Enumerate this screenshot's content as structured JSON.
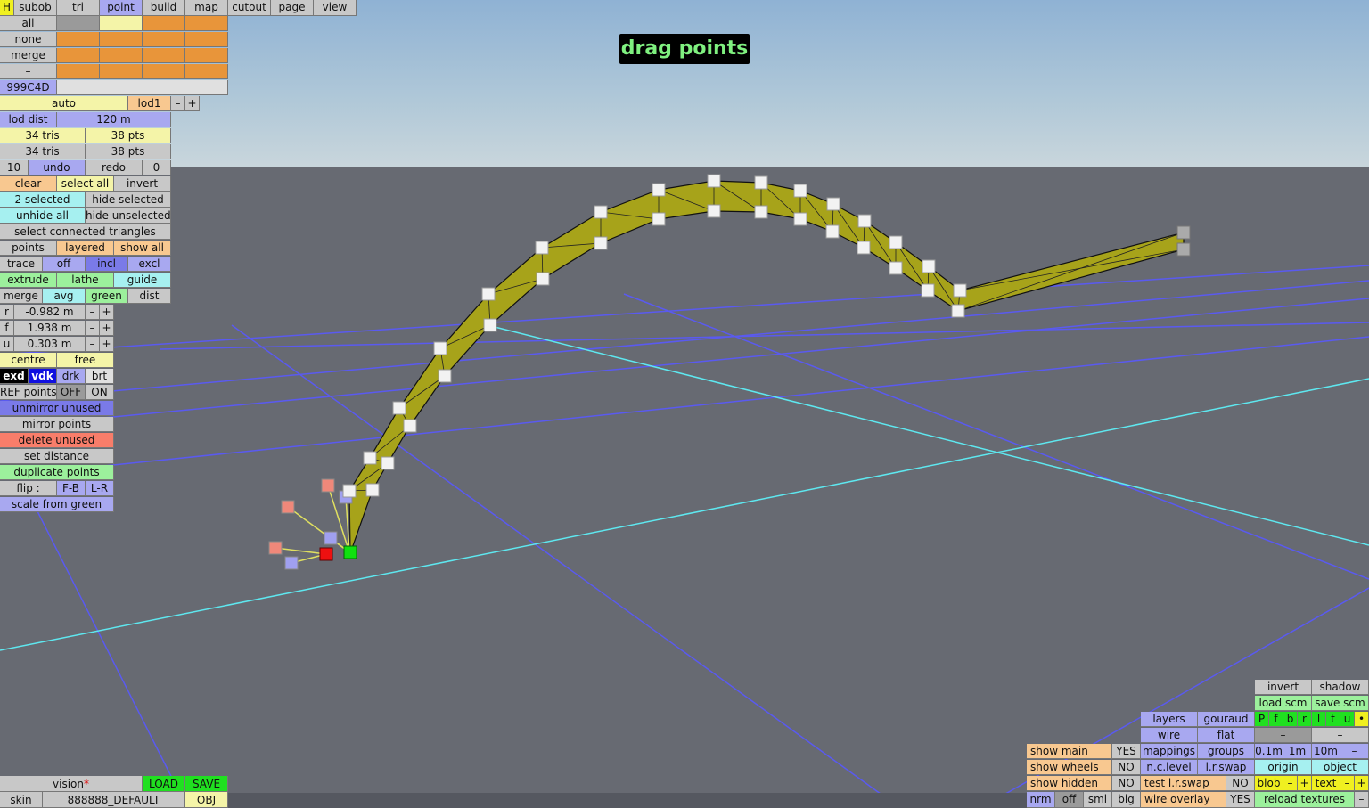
{
  "status_title": "drag points",
  "menu": {
    "h": "H",
    "tabs": [
      "subob",
      "tri",
      "point",
      "build",
      "map",
      "cutout",
      "page",
      "view"
    ],
    "active_tab": "point"
  },
  "select_rows": [
    "all",
    "none",
    "merge",
    "–"
  ],
  "color_code": "999C4D",
  "lod": {
    "auto": "auto",
    "lod1": "lod1",
    "minus": "–",
    "plus": "+",
    "dist_label": "lod dist",
    "dist_value": "120 m"
  },
  "counts": {
    "tris_a": "34 tris",
    "pts_a": "38 pts",
    "tris_b": "34 tris",
    "pts_b": "38 pts"
  },
  "history": {
    "steps": "10",
    "undo": "undo",
    "redo": "redo",
    "redo_steps": "0"
  },
  "selection": {
    "clear": "clear",
    "select_all": "select all",
    "invert": "invert",
    "selected": "2 selected",
    "hide_selected": "hide selected",
    "unhide_all": "unhide all",
    "hide_unselected": "hide unselected",
    "connected": "select connected triangles"
  },
  "modes": {
    "points": "points",
    "layered": "layered",
    "show_all": "show all",
    "trace": "trace",
    "off": "off",
    "incl": "incl",
    "excl": "excl",
    "extrude": "extrude",
    "lathe": "lathe",
    "guide": "guide",
    "merge": "merge",
    "avg": "avg",
    "green": "green",
    "dist": "dist"
  },
  "coords": [
    {
      "axis": "r",
      "value": "-0.982 m"
    },
    {
      "axis": "f",
      "value": "1.938 m"
    },
    {
      "axis": "u",
      "value": "0.303 m"
    }
  ],
  "pivot": {
    "centre": "centre",
    "free": "free"
  },
  "shade": {
    "exd": "exd",
    "vdk": "vdk",
    "drk": "drk",
    "brt": "brt"
  },
  "ref": {
    "label": "REF points",
    "off": "OFF",
    "on": "ON"
  },
  "actions": [
    "unmirror unused",
    "mirror points",
    "delete unused",
    "set distance",
    "duplicate points"
  ],
  "flip": {
    "label": "flip :",
    "fb": "F-B",
    "lr": "L-R"
  },
  "scale_from_green": "scale from green",
  "bottom_left": {
    "vision": "vision",
    "asterisk": "*",
    "load": "LOAD",
    "save": "SAVE",
    "skin": "skin",
    "skin_name": "888888_DEFAULT",
    "obj": "OBJ"
  },
  "bottom_right": {
    "invert": "invert",
    "shadow": "shadow",
    "load_scm": "load scm",
    "save_scm": "save scm",
    "layers": "layers",
    "gouraud": "gouraud",
    "layer_flags": [
      "P",
      "f",
      "b",
      "r",
      "l",
      "t",
      "u",
      "•"
    ],
    "wire": "wire",
    "flat": "flat",
    "dash": "–",
    "show_main": "show main",
    "yes": "YES",
    "mappings": "mappings",
    "groups": "groups",
    "grid_sizes": [
      "0.1m",
      "1m",
      "10m"
    ],
    "minus": "–",
    "plus": "+",
    "show_wheels": "show wheels",
    "no": "NO",
    "nc_level": "n.c.level",
    "lr_swap": "l.r.swap",
    "origin": "origin",
    "object": "object",
    "show_hidden": "show hidden",
    "test_lr_swap": "test l.r.swap",
    "blob": "blob",
    "text": "text",
    "nrm": "nrm",
    "off": "off",
    "sml": "sml",
    "big": "big",
    "wire_overlay": "wire overlay",
    "reload": "reload textures"
  }
}
